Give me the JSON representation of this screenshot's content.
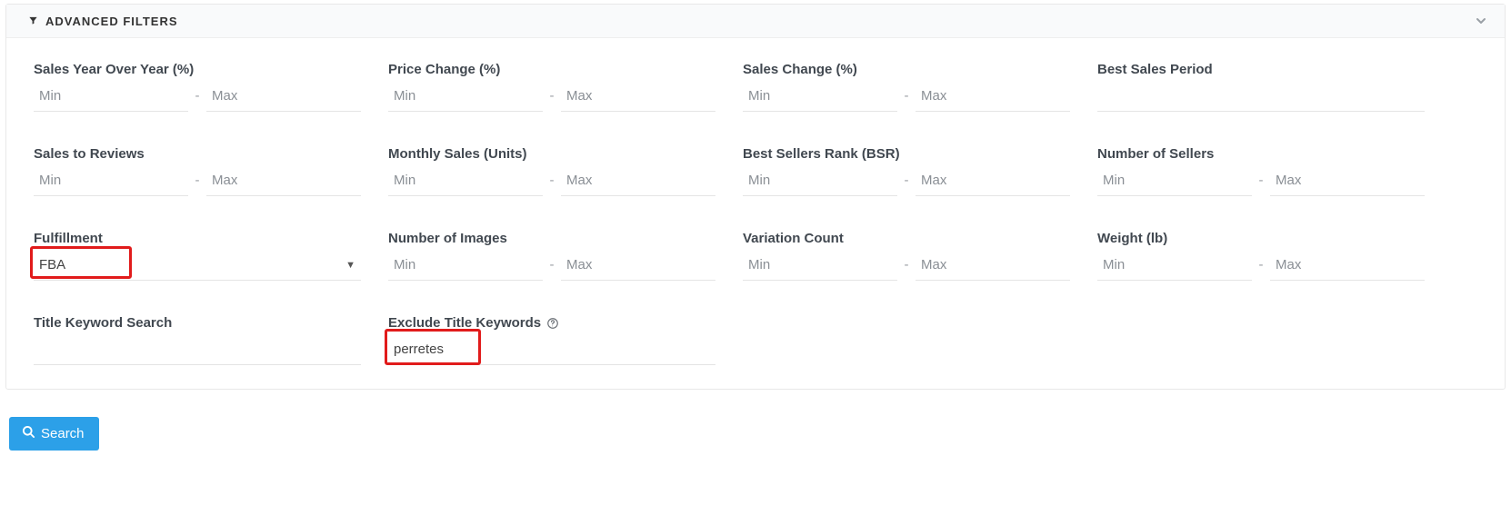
{
  "panel": {
    "title": "ADVANCED FILTERS"
  },
  "placeholders": {
    "min": "Min",
    "max": "Max"
  },
  "range_sep": "-",
  "filters": {
    "sales_yoy": {
      "label": "Sales Year Over Year (%)"
    },
    "price_change": {
      "label": "Price Change (%)"
    },
    "sales_change": {
      "label": "Sales Change (%)"
    },
    "best_sales_period": {
      "label": "Best Sales Period"
    },
    "sales_to_reviews": {
      "label": "Sales to Reviews"
    },
    "monthly_sales": {
      "label": "Monthly Sales (Units)"
    },
    "bsr": {
      "label": "Best Sellers Rank (BSR)"
    },
    "num_sellers": {
      "label": "Number of Sellers"
    },
    "fulfillment": {
      "label": "Fulfillment",
      "value": "FBA"
    },
    "num_images": {
      "label": "Number of Images"
    },
    "variation_count": {
      "label": "Variation Count"
    },
    "weight": {
      "label": "Weight (lb)"
    },
    "title_keyword": {
      "label": "Title Keyword Search"
    },
    "exclude_title": {
      "label": "Exclude Title Keywords",
      "value": "perretes"
    }
  },
  "buttons": {
    "search": "Search"
  }
}
